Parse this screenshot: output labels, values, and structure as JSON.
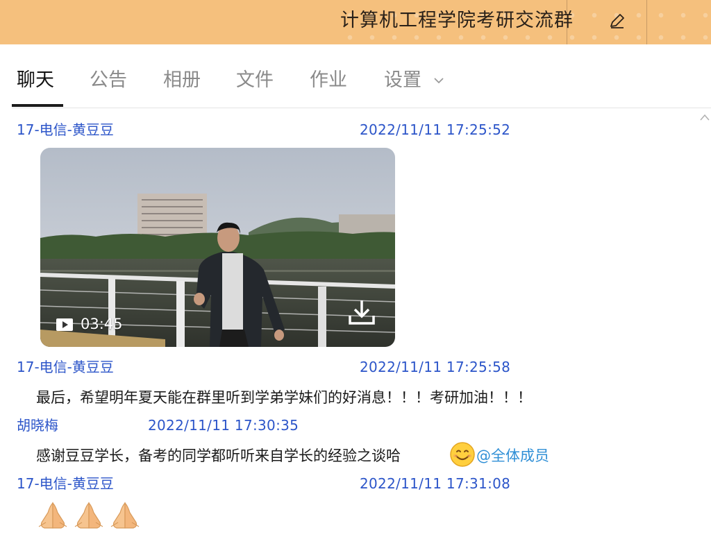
{
  "window": {
    "group_title": "计算机工程学院考研交流群",
    "edit_icon": "pencil-icon"
  },
  "tabs": [
    {
      "label": "聊天",
      "active": true
    },
    {
      "label": "公告",
      "active": false
    },
    {
      "label": "相册",
      "active": false
    },
    {
      "label": "文件",
      "active": false
    },
    {
      "label": "作业",
      "active": false
    },
    {
      "label": "设置",
      "active": false,
      "has_dropdown": true
    }
  ],
  "messages": [
    {
      "sender": "17-电信-黄豆豆",
      "time": "2022/11/11 17:25:52",
      "type": "video",
      "video": {
        "duration": "03:45",
        "play_icon": "play-icon",
        "download_icon": "download-icon"
      }
    },
    {
      "sender": "17-电信-黄豆豆",
      "time": "2022/11/11 17:25:58",
      "type": "text",
      "text": "最后，希望明年夏天能在群里听到学弟学妹们的好消息！！！考研加油！！！"
    },
    {
      "sender": "胡晓梅",
      "time": "2022/11/11 17:30:35",
      "type": "text",
      "text": "感谢豆豆学长，备考的同学都听听来自学长的经验之谈哈",
      "emoji": "smiling-face-icon",
      "mention": "@全体成员"
    },
    {
      "sender": "17-电信-黄豆豆",
      "time": "2022/11/11 17:31:08",
      "type": "emoji",
      "emojis": [
        "praying-hands-icon",
        "praying-hands-icon",
        "praying-hands-icon"
      ]
    }
  ],
  "colors": {
    "header_bg": "#f5c07d",
    "name_time": "#2c55c9",
    "mention": "#2f8fd6",
    "active_tab": "#111111",
    "inactive_tab": "#8a8a8a"
  }
}
